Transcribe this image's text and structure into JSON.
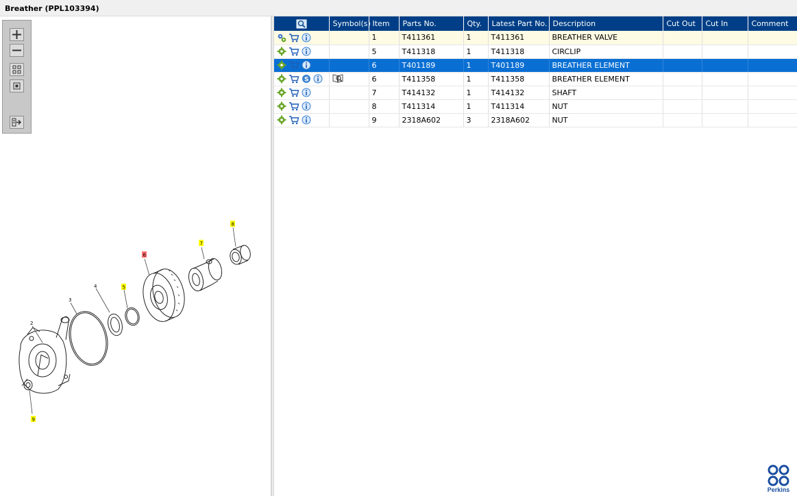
{
  "window": {
    "title": "Breather (PPL103394)"
  },
  "zoom_tools": [
    {
      "name": "zoom-in",
      "icon": "plus-icon"
    },
    {
      "name": "zoom-out",
      "icon": "minus-icon"
    },
    {
      "name": "fit-all",
      "icon": "grid-icon"
    },
    {
      "name": "actual-size",
      "icon": "square-icon"
    },
    {
      "name": "export",
      "icon": "list-arrow-icon"
    }
  ],
  "diagram": {
    "callouts": [
      "2",
      "3",
      "4",
      "5",
      "6",
      "7",
      "8",
      "9"
    ],
    "highlighted_callouts": [
      "5",
      "7",
      "8",
      "9"
    ],
    "selected_callout": "6",
    "highlight_color": "#ffff00",
    "selected_color": "#ff6f6f"
  },
  "table": {
    "columns": [
      "",
      "Symbol(s)",
      "Item",
      "Parts No.",
      "Qty.",
      "Latest Part No.",
      "Description",
      "Cut Out",
      "Cut In",
      "Comment"
    ],
    "rows": [
      {
        "icons": [
          "gears-icon",
          "cart-icon",
          "info-icon"
        ],
        "symbol": "",
        "item": "1",
        "part_no": "T411361",
        "qty": "1",
        "latest_part_no": "T411361",
        "description": "BREATHER VALVE",
        "cut_out": "",
        "cut_in": "",
        "comment": ""
      },
      {
        "icons": [
          "gear-icon",
          "cart-icon",
          "info-icon"
        ],
        "symbol": "",
        "item": "5",
        "part_no": "T411318",
        "qty": "1",
        "latest_part_no": "T411318",
        "description": "CIRCLIP",
        "cut_out": "",
        "cut_in": "",
        "comment": ""
      },
      {
        "icons": [
          "gear-icon",
          "cart-icon",
          "info-icon"
        ],
        "symbol": "",
        "item": "6",
        "part_no": "T401189",
        "qty": "1",
        "latest_part_no": "T401189",
        "description": "BREATHER ELEMENT",
        "cut_out": "",
        "cut_in": "",
        "comment": "",
        "selected": true
      },
      {
        "icons": [
          "gear-icon",
          "cart-icon",
          "s-icon",
          "info-icon"
        ],
        "symbol": "book-icon",
        "item": "6",
        "part_no": "T411358",
        "qty": "1",
        "latest_part_no": "T411358",
        "description": "BREATHER ELEMENT",
        "cut_out": "",
        "cut_in": "",
        "comment": ""
      },
      {
        "icons": [
          "gear-icon",
          "cart-icon",
          "info-icon"
        ],
        "symbol": "",
        "item": "7",
        "part_no": "T414132",
        "qty": "1",
        "latest_part_no": "T414132",
        "description": "SHAFT",
        "cut_out": "",
        "cut_in": "",
        "comment": ""
      },
      {
        "icons": [
          "gear-icon",
          "cart-icon",
          "info-icon"
        ],
        "symbol": "",
        "item": "8",
        "part_no": "T411314",
        "qty": "1",
        "latest_part_no": "T411314",
        "description": "NUT",
        "cut_out": "",
        "cut_in": "",
        "comment": ""
      },
      {
        "icons": [
          "gear-icon",
          "cart-icon",
          "info-icon"
        ],
        "symbol": "",
        "item": "9",
        "part_no": "2318A602",
        "qty": "3",
        "latest_part_no": "2318A602",
        "description": "NUT",
        "cut_out": "",
        "cut_in": "",
        "comment": ""
      }
    ]
  },
  "brand": {
    "logo_text": "Perkins",
    "color": "#1b4fa0"
  },
  "colors": {
    "header": "#003f87",
    "selected_row": "#0a6fd3",
    "first_row": "#fdfbe3"
  }
}
